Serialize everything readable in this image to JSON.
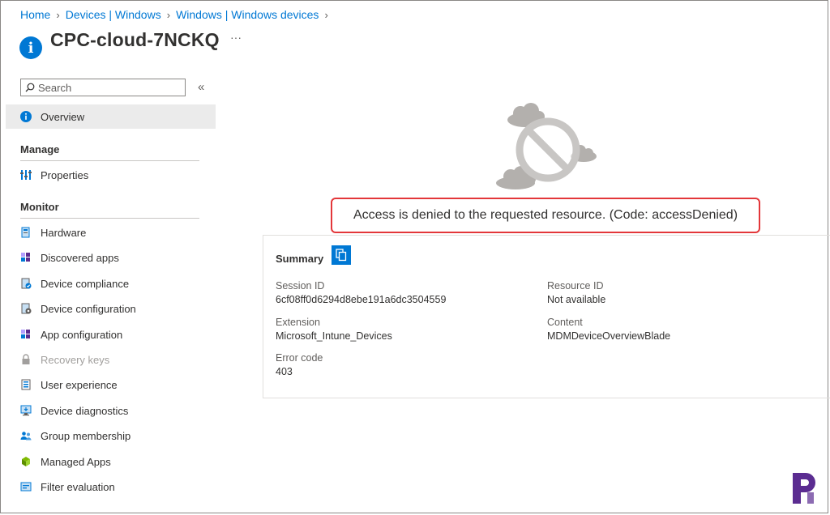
{
  "breadcrumb": [
    "Home",
    "Devices | Windows",
    "Windows | Windows devices"
  ],
  "header": {
    "title": "CPC-cloud-7NCKQ",
    "more": "···"
  },
  "search": {
    "placeholder": "Search",
    "collapse": "«"
  },
  "nav": {
    "overview": "Overview",
    "manage_title": "Manage",
    "properties": "Properties",
    "monitor_title": "Monitor",
    "items": [
      {
        "label": "Hardware",
        "icon": "hardware-icon"
      },
      {
        "label": "Discovered apps",
        "icon": "apps-icon"
      },
      {
        "label": "Device compliance",
        "icon": "compliance-icon"
      },
      {
        "label": "Device configuration",
        "icon": "configuration-icon"
      },
      {
        "label": "App configuration",
        "icon": "app-config-icon"
      },
      {
        "label": "Recovery keys",
        "icon": "lock-icon",
        "disabled": true
      },
      {
        "label": "User experience",
        "icon": "user-experience-icon"
      },
      {
        "label": "Device diagnostics",
        "icon": "diagnostics-icon"
      },
      {
        "label": "Group membership",
        "icon": "group-icon"
      },
      {
        "label": "Managed Apps",
        "icon": "managed-apps-icon"
      },
      {
        "label": "Filter evaluation",
        "icon": "filter-icon"
      }
    ]
  },
  "error": {
    "message": "Access is denied to the requested resource. (Code: accessDenied)"
  },
  "summary": {
    "title": "Summary",
    "session_id_label": "Session ID",
    "session_id": "6cf08ff0d6294d8ebe191a6dc3504559",
    "resource_id_label": "Resource ID",
    "resource_id": "Not available",
    "extension_label": "Extension",
    "extension": "Microsoft_Intune_Devices",
    "content_label": "Content",
    "content": "MDMDeviceOverviewBlade",
    "error_code_label": "Error code",
    "error_code": "403"
  },
  "colors": {
    "accent": "#0078d4",
    "error_border": "#e3373a",
    "logo": "#5b2c91"
  }
}
